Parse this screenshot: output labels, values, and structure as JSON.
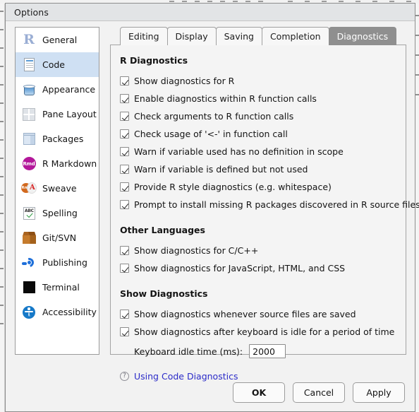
{
  "window": {
    "title": "Options"
  },
  "sidebar": {
    "items": [
      {
        "label": "General",
        "icon": "r-logo-icon",
        "selected": false
      },
      {
        "label": "Code",
        "icon": "code-document-icon",
        "selected": true
      },
      {
        "label": "Appearance",
        "icon": "paint-bucket-icon",
        "selected": false
      },
      {
        "label": "Pane Layout",
        "icon": "pane-layout-icon",
        "selected": false
      },
      {
        "label": "Packages",
        "icon": "package-box-icon",
        "selected": false
      },
      {
        "label": "R Markdown",
        "icon": "rmd-circle-icon",
        "selected": false
      },
      {
        "label": "Sweave",
        "icon": "sweave-pdf-icon",
        "selected": false
      },
      {
        "label": "Spelling",
        "icon": "abc-check-icon",
        "selected": false
      },
      {
        "label": "Git/SVN",
        "icon": "carton-box-icon",
        "selected": false
      },
      {
        "label": "Publishing",
        "icon": "publish-rings-icon",
        "selected": false
      },
      {
        "label": "Terminal",
        "icon": "terminal-icon",
        "selected": false
      },
      {
        "label": "Accessibility",
        "icon": "accessibility-icon",
        "selected": false
      }
    ]
  },
  "tabs": [
    {
      "label": "Editing",
      "active": false
    },
    {
      "label": "Display",
      "active": false
    },
    {
      "label": "Saving",
      "active": false
    },
    {
      "label": "Completion",
      "active": false
    },
    {
      "label": "Diagnostics",
      "active": true
    }
  ],
  "sections": [
    {
      "title": "R Diagnostics",
      "checkboxes": [
        {
          "label": "Show diagnostics for R",
          "checked": true
        },
        {
          "label": "Enable diagnostics within R function calls",
          "checked": true
        },
        {
          "label": "Check arguments to R function calls",
          "checked": true
        },
        {
          "label": "Check usage of '<-' in function call",
          "checked": true
        },
        {
          "label": "Warn if variable used has no definition in scope",
          "checked": true
        },
        {
          "label": "Warn if variable is defined but not used",
          "checked": true
        },
        {
          "label": "Provide R style diagnostics (e.g. whitespace)",
          "checked": true
        },
        {
          "label": "Prompt to install missing R packages discovered in R source files",
          "checked": true
        }
      ]
    },
    {
      "title": "Other Languages",
      "checkboxes": [
        {
          "label": "Show diagnostics for C/C++",
          "checked": true
        },
        {
          "label": "Show diagnostics for JavaScript, HTML, and CSS",
          "checked": true
        }
      ]
    },
    {
      "title": "Show Diagnostics",
      "checkboxes": [
        {
          "label": "Show diagnostics whenever source files are saved",
          "checked": true
        },
        {
          "label": "Show diagnostics after keyboard is idle for a period of time",
          "checked": true
        }
      ]
    }
  ],
  "idle_time": {
    "label": "Keyboard idle time (ms):",
    "value": "2000",
    "placeholder": "2000"
  },
  "help": {
    "icon": "question-mark-icon",
    "glyph": "?",
    "link_text": "Using Code Diagnostics"
  },
  "buttons": [
    {
      "label": "OK",
      "default": true
    },
    {
      "label": "Cancel",
      "default": false
    },
    {
      "label": "Apply",
      "default": false
    }
  ],
  "colors": {
    "selection": "#cfe0f3",
    "active_tab": "#8f8f8f",
    "link": "#2b2bc8",
    "titlebar": "#e2e4e6",
    "panel": "#f4f4f4"
  }
}
